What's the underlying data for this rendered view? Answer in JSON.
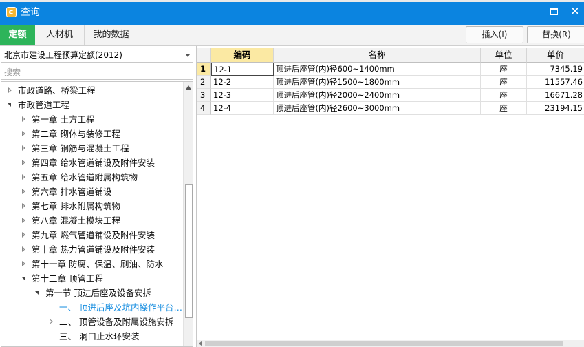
{
  "window": {
    "title": "查询",
    "colors": {
      "titlebar": "#0b84e0",
      "active_tab": "#2db45a",
      "selected_text": "#1a8fe0",
      "code_header": "#fbe9a3"
    }
  },
  "tabs": [
    {
      "label": "定额",
      "active": true
    },
    {
      "label": "人材机",
      "active": false
    },
    {
      "label": "我的数据",
      "active": false
    }
  ],
  "toolbar": {
    "insert_label": "插入(I)",
    "replace_label": "替换(R)"
  },
  "left": {
    "library": "北京市建设工程预算定额(2012)",
    "search_placeholder": "搜索",
    "tree": [
      {
        "label": "市政道路、桥梁工程",
        "level": 0,
        "state": "collapsed"
      },
      {
        "label": "市政管道工程",
        "level": 0,
        "state": "expanded"
      },
      {
        "label": "第一章  土方工程",
        "level": 1,
        "state": "collapsed"
      },
      {
        "label": "第二章  砌体与装修工程",
        "level": 1,
        "state": "collapsed"
      },
      {
        "label": "第三章  钢筋与混凝土工程",
        "level": 1,
        "state": "collapsed"
      },
      {
        "label": "第四章  给水管道铺设及附件安装",
        "level": 1,
        "state": "collapsed"
      },
      {
        "label": "第五章  给水管道附属构筑物",
        "level": 1,
        "state": "collapsed"
      },
      {
        "label": "第六章  排水管道铺设",
        "level": 1,
        "state": "collapsed"
      },
      {
        "label": "第七章  排水附属构筑物",
        "level": 1,
        "state": "collapsed"
      },
      {
        "label": "第八章  混凝土模块工程",
        "level": 1,
        "state": "collapsed"
      },
      {
        "label": "第九章  燃气管道铺设及附件安装",
        "level": 1,
        "state": "collapsed"
      },
      {
        "label": "第十章  热力管道铺设及附件安装",
        "level": 1,
        "state": "collapsed"
      },
      {
        "label": "第十一章  防腐、保温、刷油、防水",
        "level": 1,
        "state": "collapsed"
      },
      {
        "label": "第十二章  顶管工程",
        "level": 1,
        "state": "expanded"
      },
      {
        "label": "第一节  顶进后座及设备安拆",
        "level": 2,
        "state": "expanded"
      },
      {
        "label": "一、  顶进后座及坑内操作平台…",
        "level": 3,
        "state": "leaf",
        "selected": true
      },
      {
        "label": "二、  顶管设备及附属设施安拆",
        "level": 3,
        "state": "collapsed"
      },
      {
        "label": "三、  洞口止水环安装",
        "level": 3,
        "state": "leaf"
      }
    ]
  },
  "grid": {
    "columns": [
      "编码",
      "名称",
      "单位",
      "单价"
    ],
    "rows": [
      {
        "num": "1",
        "code": "12-1",
        "name": "顶进后座管(内)径600~1400mm",
        "unit": "座",
        "price": "7345.19"
      },
      {
        "num": "2",
        "code": "12-2",
        "name": "顶进后座管(内)径1500~1800mm",
        "unit": "座",
        "price": "11557.46"
      },
      {
        "num": "3",
        "code": "12-3",
        "name": "顶进后座管(内)径2000~2400mm",
        "unit": "座",
        "price": "16671.28"
      },
      {
        "num": "4",
        "code": "12-4",
        "name": "顶进后座管(内)径2600~3000mm",
        "unit": "座",
        "price": "23194.15"
      }
    ]
  }
}
